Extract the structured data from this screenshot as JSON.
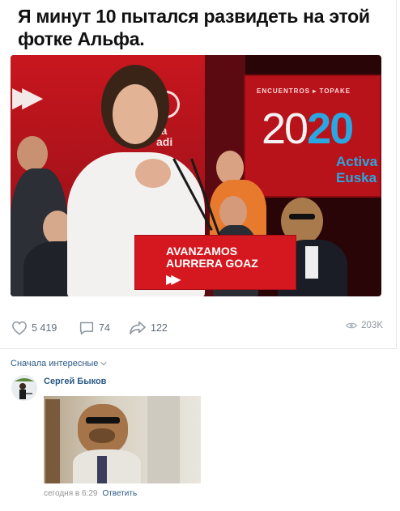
{
  "post": {
    "title": "Я минут 10 пытался развидеть на этой фотке Альфа.",
    "photo": {
      "screen_label": "ENCUENTROS ▸ TOPAKE",
      "screen_year_a": "20",
      "screen_year_b": "20",
      "screen_sub": "Activa\nEuska",
      "podium_text": "AVANZAMOS\nAURRERA GOAZ",
      "vertical_text": "ra\nadi"
    }
  },
  "actions": {
    "likes": "5 419",
    "comments": "74",
    "shares": "122",
    "views": "203K"
  },
  "comments_section": {
    "sort_label": "Сначала интересные",
    "comment": {
      "author": "Сергей Быков",
      "time": "сегодня в 6:29",
      "reply_label": "Ответить"
    }
  },
  "colors": {
    "link": "#2a5885",
    "icon_gray": "#8d96a0",
    "podium_red": "#d5181f",
    "accent_blue": "#2aa7e0"
  },
  "icons": [
    "heart-icon",
    "comment-icon",
    "share-icon",
    "eye-icon",
    "chevron-down-icon"
  ]
}
